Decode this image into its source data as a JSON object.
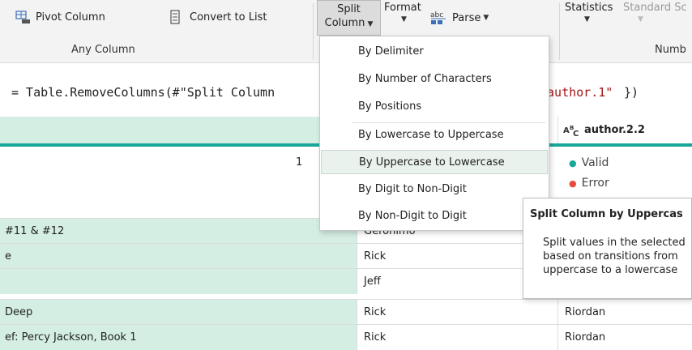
{
  "ribbon": {
    "pivot_label": "Pivot Column",
    "convert_label": "Convert to List",
    "group_label": "Any Column",
    "split_line1": "Split",
    "split_line2": "Column",
    "format_label": "Format",
    "parse_label": "Parse",
    "statistics_label": "Statistics",
    "standard_label": "Standard Sc",
    "number_group_label": "Numb"
  },
  "formula": {
    "text": "= Table.RemoveColumns(#\"Split Column",
    "tail_string": "\"author.1\"",
    "tail_close": "})"
  },
  "grid": {
    "right_header_type": "A B C",
    "right_header_label": "author.2.2",
    "stat_count": "1",
    "valid_label": "Valid",
    "error_label": "Error",
    "valid_color": "#1aa699",
    "error_color": "#e74c3c",
    "rows": [
      {
        "c1": "#11 & #12",
        "c2": "Geronimo",
        "c3": ""
      },
      {
        "c1": "e",
        "c2": "Rick",
        "c3": ""
      },
      {
        "c1": "",
        "c2": "Jeff",
        "c3": ""
      },
      {
        "c1": "Deep",
        "c2": "Rick",
        "c3": "Riordan"
      },
      {
        "c1": "ef: Percy Jackson, Book 1",
        "c2": "Rick",
        "c3": "Riordan"
      }
    ]
  },
  "menu": {
    "items": [
      "By Delimiter",
      "By Number of Characters",
      "By Positions",
      "By Lowercase to Uppercase",
      "By Uppercase to Lowercase",
      "By Digit to Non-Digit",
      "By Non-Digit to Digit"
    ]
  },
  "tooltip": {
    "title": "Split Column by Uppercas",
    "line1": "Split values in the selected",
    "line2": "based on transitions from",
    "line3": "uppercase to a lowercase"
  }
}
